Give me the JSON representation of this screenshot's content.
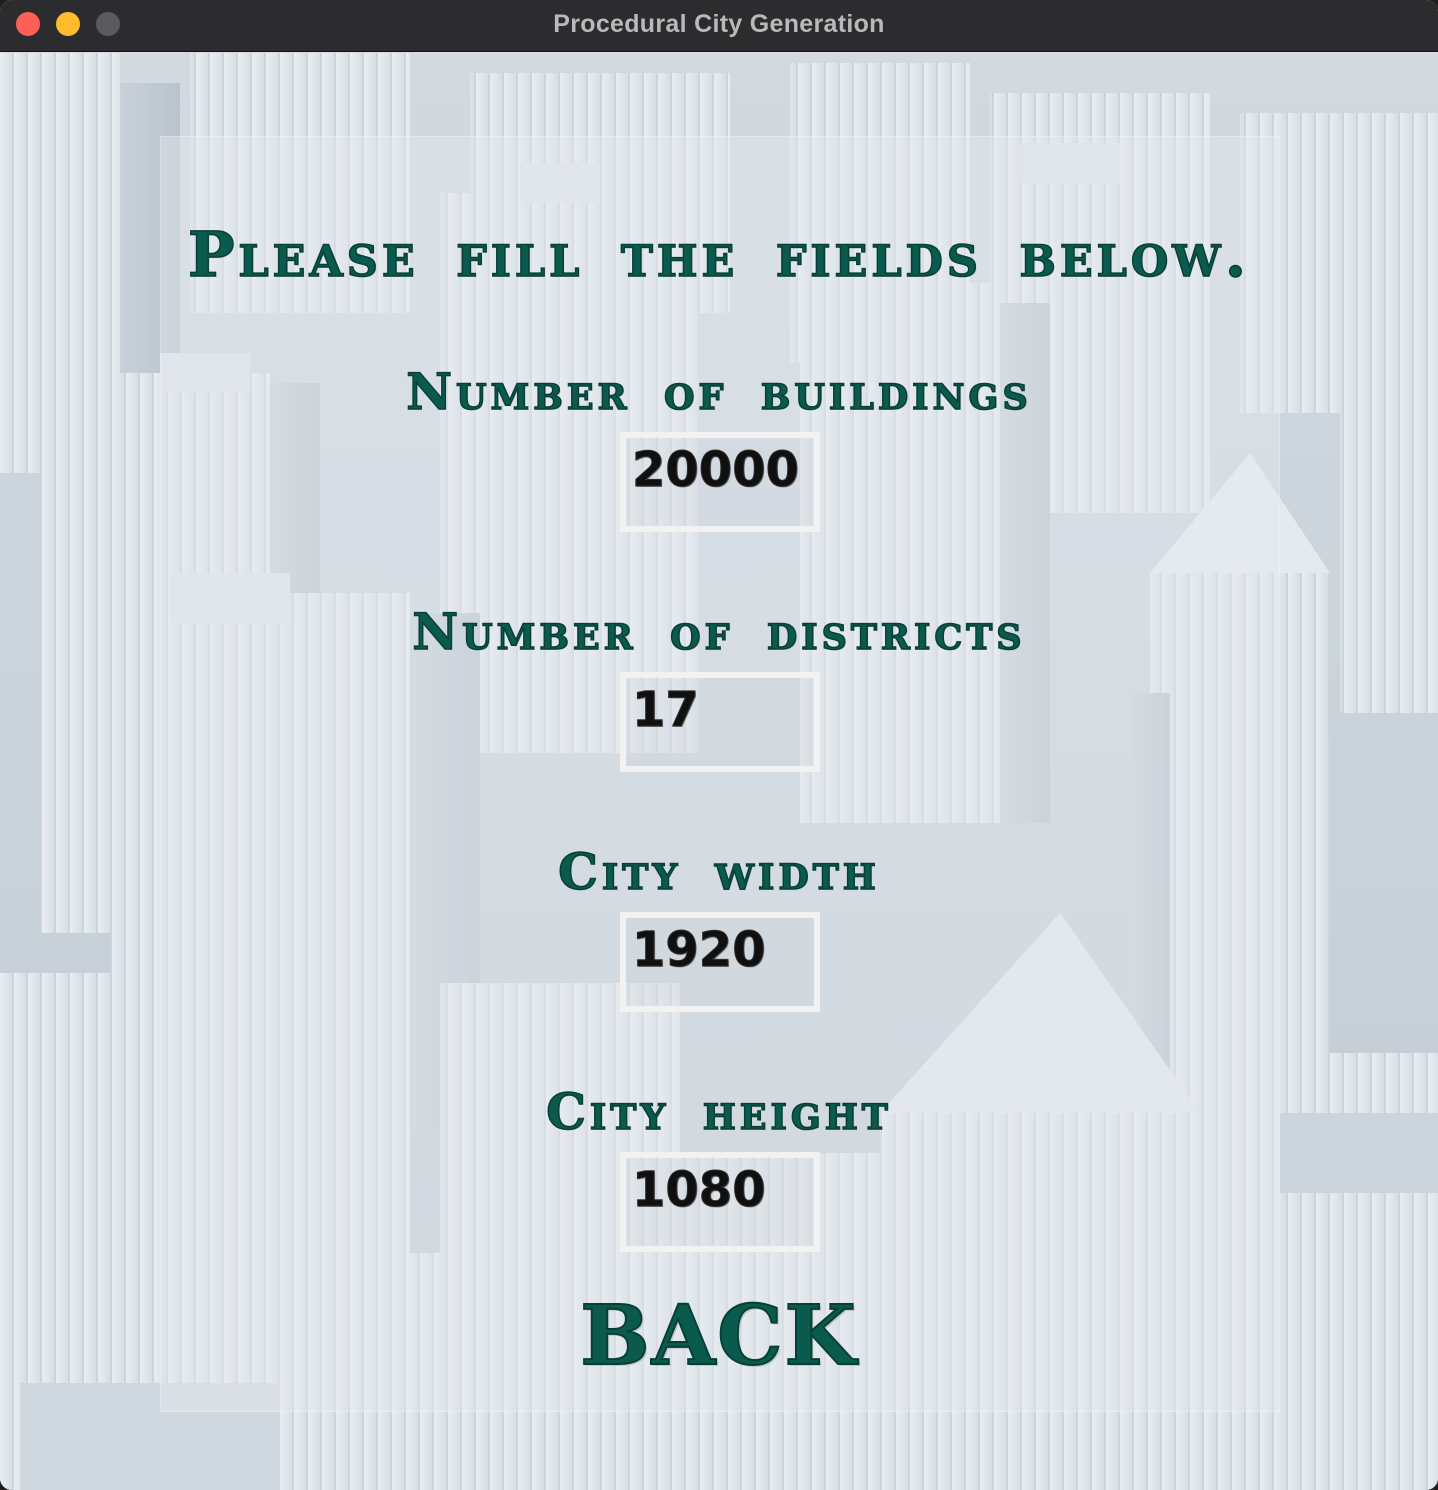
{
  "window": {
    "title": "Procedural City Generation"
  },
  "form": {
    "heading": "Please fill the fields below.",
    "fields": [
      {
        "label": "Number of buildings",
        "value": "20000"
      },
      {
        "label": "Number of districts",
        "value": "17"
      },
      {
        "label": "City width",
        "value": "1920"
      },
      {
        "label": "City height",
        "value": "1080"
      }
    ],
    "back_label": "BACK"
  },
  "colors": {
    "accent_text": "#0b5a4e",
    "input_border": "#f2f2f2",
    "titlebar": "#2c2c2e"
  }
}
